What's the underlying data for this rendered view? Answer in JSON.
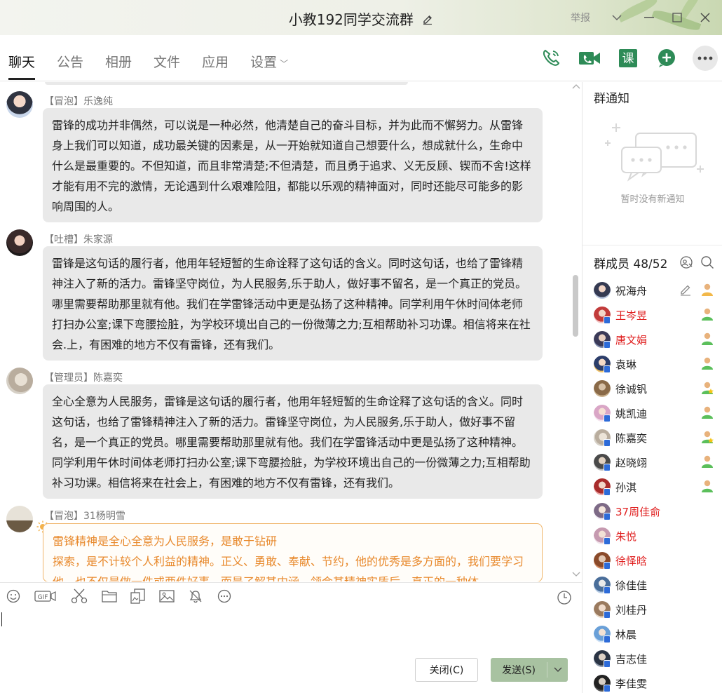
{
  "window": {
    "title": "小教192同学交流群",
    "report_label": "举报"
  },
  "tabs": [
    {
      "label": "聊天",
      "active": true
    },
    {
      "label": "公告"
    },
    {
      "label": "相册"
    },
    {
      "label": "文件"
    },
    {
      "label": "应用"
    },
    {
      "label": "设置"
    }
  ],
  "toolbar_icons": [
    "voice-call-icon",
    "video-call-icon",
    "class-icon",
    "add-app-icon",
    "more-icon"
  ],
  "toolbar": {
    "class_glyph": "课"
  },
  "messages": [
    {
      "tag": "【冒泡】",
      "name": "乐逸纯",
      "text": "雷锋的成功并非偶然，可以说是一种必然，他清楚自己的奋斗目标，并为此而不懈努力。从雷锋身上我们可以知道，成功最关键的因素是，从一开始就知道自己想要什么，想成就什么，生命中什么是最重要的。不但知道，而且非常清楚;不但清楚，而且勇于追求、义无反顾、锲而不舍!这样才能有用不完的激情，无论遇到什么艰难险阻，都能以乐观的精神面对，同时还能尽可能多的影响周围的人。"
    },
    {
      "tag": "【吐槽】",
      "name": "朱家源",
      "text": "雷锋是这句话的履行者，他用年轻短暂的生命诠释了这句话的含义。同时这句话，也给了雷锋精神注入了新的活力。雷锋坚守岗位，为人民服务,乐于助人，做好事不留名，是一个真正的党员。哪里需要帮助那里就有他。我们在学雷锋活动中更是弘扬了这种精神。同学利用午休时间体老师打扫办公室;课下弯腰捡脏，为学校环境出自己的一份微薄之力;互相帮助补习功课。相信将来在社会.上，有困难的地方不仅有雷锋，还有我们。"
    },
    {
      "tag": "【管理员】",
      "name": "陈嘉奕",
      "text": "全心全意为人民服务，雷锋是这句话的履行者，他用年轻短暂的生命诠释了这句话的含义。同时这句话，也给了雷锋精神注入了新的活力。雷锋坚守岗位，为人民服务,乐于助人，做好事不留名，是一个真正的党员。哪里需要帮助那里就有他。我们在学雷锋活动中更是弘扬了这种精神。同学利用午休时间体老师打扫办公室;课下弯腰捡脏，为学校环境出自己的一份微薄之力;互相帮助补习功课。相信将来在社会上，有困难的地方不仅有雷锋，还有我们。"
    },
    {
      "tag": "【冒泡】",
      "name": "31杨明雪",
      "text_line1": "雷锋精神是全心全意为人民服务，是敢于钻研",
      "text_line2": " 探索，是不计较个人利益的精神。正义、勇敢、奉献、节约，他的优秀是多方面的，我们要学习他，也不仅是做一件或两件好事，而是了解其内涵，领会其精神实质后，真正的一种体"
    }
  ],
  "input_toolbar_icons": [
    "emoji-icon",
    "gif-icon",
    "scissors-icon",
    "folder-icon",
    "image-transfer-icon",
    "picture-icon",
    "bell-icon",
    "more-circle-icon",
    "clock-icon"
  ],
  "input_toolbar": {
    "gif_text": "GIF"
  },
  "buttons": {
    "close": "关闭(C)",
    "send": "发送(S)"
  },
  "notice": {
    "title": "群通知",
    "empty_text": "暂时没有新通知"
  },
  "members_header": {
    "title": "群成员 48/52"
  },
  "members": [
    {
      "name": "祝海舟",
      "red": false,
      "role": "owner"
    },
    {
      "name": "王岑昱",
      "red": true,
      "role": "member"
    },
    {
      "name": "唐文娟",
      "red": true,
      "role": "member"
    },
    {
      "name": "袁琳",
      "red": false,
      "role": "member"
    },
    {
      "name": "徐诚钒",
      "red": false,
      "role": "admin"
    },
    {
      "name": "姚凯迪",
      "red": false,
      "role": "member"
    },
    {
      "name": "陈嘉奕",
      "red": false,
      "role": "admin"
    },
    {
      "name": "赵晓翊",
      "red": false,
      "role": "member"
    },
    {
      "name": "孙淇",
      "red": false,
      "role": "member"
    },
    {
      "name": "37周佳俞",
      "red": true,
      "role": ""
    },
    {
      "name": "朱悦",
      "red": true,
      "role": ""
    },
    {
      "name": "徐怿晗",
      "red": true,
      "role": ""
    },
    {
      "name": "徐佳佳",
      "red": false,
      "role": ""
    },
    {
      "name": "刘桂丹",
      "red": false,
      "role": ""
    },
    {
      "name": "林晨",
      "red": false,
      "role": ""
    },
    {
      "name": "吉志佳",
      "red": false,
      "role": ""
    },
    {
      "name": "李佳雯",
      "red": false,
      "role": ""
    }
  ],
  "colors": {
    "accent_green": "#2e8b57",
    "send_button": "#a8c2a1",
    "highlight_orange": "#e8892c",
    "member_red": "#e02020"
  }
}
